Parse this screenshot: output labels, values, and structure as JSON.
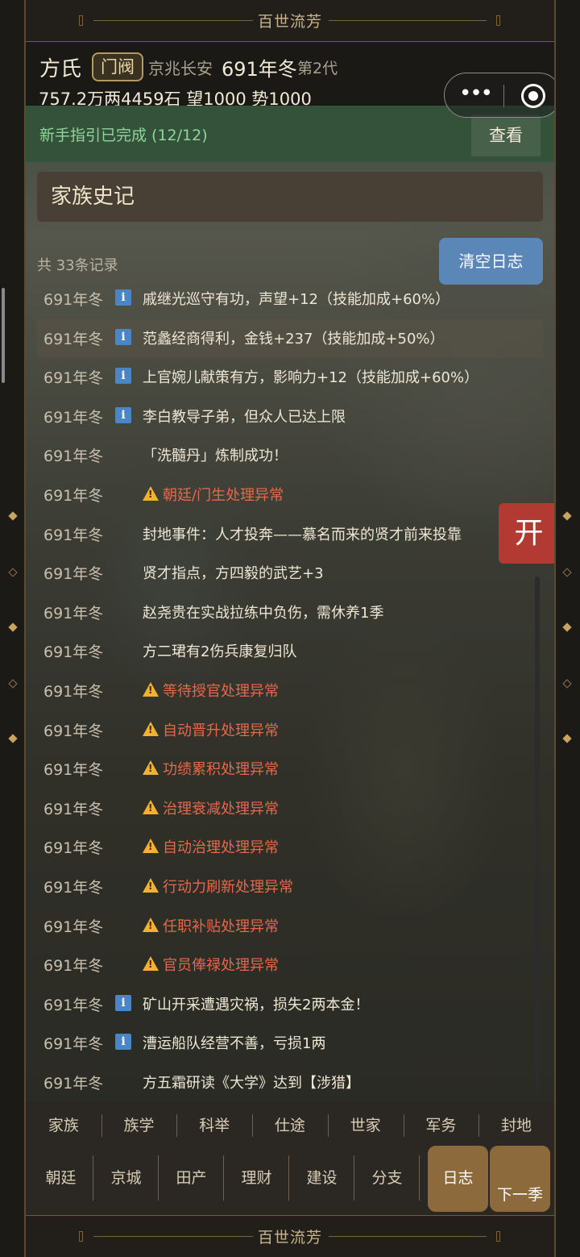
{
  "app_title": "百世流芳",
  "header": {
    "family_name": "方氏",
    "rank": "门阀",
    "location": "京兆长安",
    "year": "691年冬",
    "generation": "第2代",
    "resources": "757.2万两4459石  望1000  势1000"
  },
  "capsule": {
    "menu_icon": "more-dots-icon",
    "close_icon": "target-circle-icon"
  },
  "guide": {
    "text": "新手指引已完成 (12/12)",
    "button": "查看"
  },
  "section_title": "家族史记",
  "log": {
    "count": "共 33条记录",
    "clear_button": "清空日志",
    "entries": [
      {
        "time": "691年冬",
        "type": "info",
        "text": "戚继光巡守有功，声望+12（技能加成+60%）"
      },
      {
        "time": "691年冬",
        "type": "info",
        "text": "范蠡经商得利，金钱+237（技能加成+50%）"
      },
      {
        "time": "691年冬",
        "type": "info",
        "text": "上官婉儿献策有方，影响力+12（技能加成+60%）"
      },
      {
        "time": "691年冬",
        "type": "info",
        "text": "李白教导子弟，但众人已达上限"
      },
      {
        "time": "691年冬",
        "type": "plain",
        "text": "「洗髓丹」炼制成功！"
      },
      {
        "time": "691年冬",
        "type": "warn",
        "text": "朝廷/门生处理异常"
      },
      {
        "time": "691年冬",
        "type": "plain",
        "text": "封地事件：人才投奔——慕名而来的贤才前来投靠"
      },
      {
        "time": "691年冬",
        "type": "plain",
        "text": "贤才指点，方四毅的武艺+3"
      },
      {
        "time": "691年冬",
        "type": "plain",
        "text": "赵尧贵在实战拉练中负伤，需休养1季"
      },
      {
        "time": "691年冬",
        "type": "plain",
        "text": "方二珺有2伤兵康复归队"
      },
      {
        "time": "691年冬",
        "type": "warn",
        "text": "等待授官处理异常"
      },
      {
        "time": "691年冬",
        "type": "warn",
        "text": "自动晋升处理异常"
      },
      {
        "time": "691年冬",
        "type": "warn",
        "text": "功绩累积处理异常"
      },
      {
        "time": "691年冬",
        "type": "warn",
        "text": "治理衰减处理异常"
      },
      {
        "time": "691年冬",
        "type": "warn",
        "text": "自动治理处理异常"
      },
      {
        "time": "691年冬",
        "type": "warn",
        "text": "行动力刷新处理异常"
      },
      {
        "time": "691年冬",
        "type": "warn",
        "text": "任职补贴处理异常"
      },
      {
        "time": "691年冬",
        "type": "warn",
        "text": "官员俸禄处理异常"
      },
      {
        "time": "691年冬",
        "type": "info",
        "text": "矿山开采遭遇灾祸，损失2两本金！"
      },
      {
        "time": "691年冬",
        "type": "info",
        "text": "漕运船队经营不善，亏损1两"
      },
      {
        "time": "691年冬",
        "type": "plain",
        "text": "方五霜研读《大学》达到【涉猎】"
      }
    ]
  },
  "float_button": "开",
  "nav": {
    "row1": [
      "家族",
      "族学",
      "科举",
      "仕途",
      "世家",
      "军务",
      "封地"
    ],
    "row2": [
      "朝廷",
      "京城",
      "田产",
      "理财",
      "建设",
      "分支",
      "日志"
    ],
    "active": "日志",
    "next": "下一季"
  }
}
